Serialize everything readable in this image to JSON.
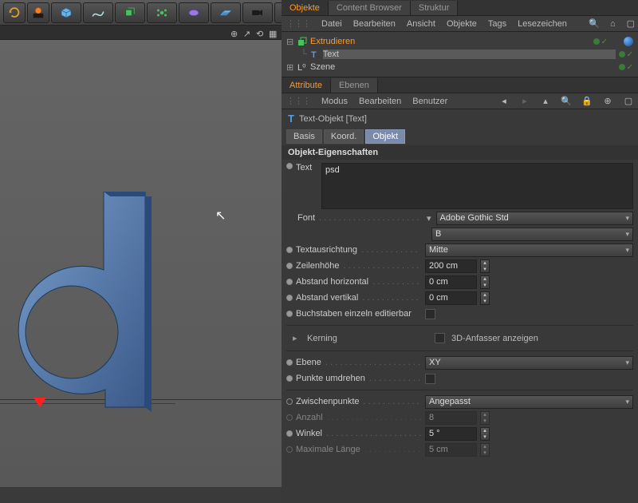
{
  "tabs_top": {
    "objects": "Objekte",
    "content_browser": "Content Browser",
    "structure": "Struktur"
  },
  "obj_menu": {
    "file": "Datei",
    "edit": "Bearbeiten",
    "view": "Ansicht",
    "objects": "Objekte",
    "tags": "Tags",
    "bookmarks": "Lesezeichen"
  },
  "tree": {
    "extrude": "Extrudieren",
    "text": "Text",
    "scene": "Szene"
  },
  "attr_tabs": {
    "attributes": "Attribute",
    "layers": "Ebenen"
  },
  "attr_menu": {
    "mode": "Modus",
    "edit": "Bearbeiten",
    "user": "Benutzer"
  },
  "obj_title": "Text-Objekt [Text]",
  "subtabs": {
    "basic": "Basis",
    "coord": "Koord.",
    "object": "Objekt"
  },
  "section": "Objekt-Eigenschaften",
  "p": {
    "text_label": "Text",
    "text_value": "psd",
    "font_label": "Font",
    "font_value": "Adobe Gothic Std",
    "font_weight": "B",
    "align_label": "Textausrichtung",
    "align_value": "Mitte",
    "lineheight_label": "Zeilenhöhe",
    "lineheight_value": "200 cm",
    "hspace_label": "Abstand horizontal",
    "hspace_value": "0 cm",
    "vspace_label": "Abstand vertikal",
    "vspace_value": "0 cm",
    "editable_label": "Buchstaben einzeln editierbar",
    "kerning_label": "Kerning",
    "kerning_3d": "3D-Anfasser anzeigen",
    "plane_label": "Ebene",
    "plane_value": "XY",
    "flip_label": "Punkte umdrehen",
    "intermed_label": "Zwischenpunkte",
    "intermed_value": "Angepasst",
    "count_label": "Anzahl",
    "count_value": "8",
    "angle_label": "Winkel",
    "angle_value": "5 °",
    "maxlen_label": "Maximale Länge",
    "maxlen_value": "5 cm"
  }
}
